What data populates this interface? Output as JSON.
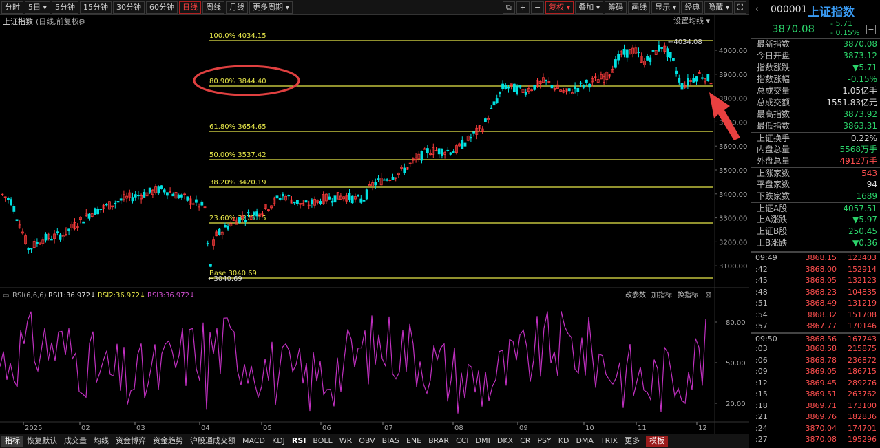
{
  "toolbar": {
    "items": [
      "分时",
      "5日 ▾",
      "5分钟",
      "15分钟",
      "30分钟",
      "60分钟",
      "日线",
      "周线",
      "月线",
      "更多周期 ▾"
    ],
    "right": [
      "复权 ▾",
      "叠加 ▾",
      "筹码",
      "画线",
      "显示 ▾",
      "经典",
      "隐藏 ▾"
    ]
  },
  "chart": {
    "title": "上证指数",
    "subtitle": "(日线,前复权)",
    "setting": "设置均线 ▾",
    "fib": [
      {
        "label": "100.0% 4034.15"
      },
      {
        "label": "80.90% 3844.40"
      },
      {
        "label": "61.80% 3654.65"
      },
      {
        "label": "50.00% 3537.42"
      },
      {
        "label": "38.20% 3420.19"
      },
      {
        "label": "23.60% 3275.15"
      },
      {
        "label": "Base   3040.69"
      }
    ],
    "high_label": "4034.08",
    "low_label": "3040.69",
    "yticks": [
      "4000.00",
      "3900.00",
      "3800.00",
      "3700.00",
      "3600.00",
      "3500.00",
      "3400.00",
      "3300.00",
      "3200.00",
      "3100.00"
    ]
  },
  "rsi": {
    "title": "RSI(6,6,6)",
    "rsi1": "RSI1:36.972",
    "rsi2": "RSI2:36.972",
    "rsi3": "RSI3:36.972",
    "actions": [
      "改参数",
      "加指标",
      "换指标"
    ],
    "yticks": [
      "80.00",
      "50.00",
      "20.00"
    ]
  },
  "xaxis": [
    "2025",
    "02",
    "03",
    "04",
    "05",
    "06",
    "07",
    "08",
    "09",
    "10",
    "11",
    "12"
  ],
  "bottom_tabs": [
    "指标",
    "恢复默认",
    "成交量",
    "均线",
    "资金博弈",
    "资金趋势",
    "沪股通成交额",
    "MACD",
    "KDJ",
    "RSI",
    "BOLL",
    "WR",
    "OBV",
    "BIAS",
    "ENE",
    "BRAR",
    "CCI",
    "DMI",
    "DKX",
    "CR",
    "PSY",
    "KD",
    "DMA",
    "TRIX",
    "更多",
    "模板"
  ],
  "panel": {
    "code": "000001",
    "name": "上证指数",
    "price": "3870.08",
    "change": "- 5.71",
    "change_pct": "- 0.15%",
    "quotes": [
      {
        "k": "最新指数",
        "v": "3870.08",
        "c": "g"
      },
      {
        "k": "今日开盘",
        "v": "3873.12",
        "c": "g"
      },
      {
        "k": "指数涨跌",
        "v": "▼5.71",
        "c": "g"
      },
      {
        "k": "指数涨幅",
        "v": "-0.15%",
        "c": "g"
      },
      {
        "k": "总成交量",
        "v": "1.05亿手",
        "c": "w"
      },
      {
        "k": "总成交额",
        "v": "1551.83亿元",
        "c": "w"
      },
      {
        "k": "最高指数",
        "v": "3873.92",
        "c": "g"
      },
      {
        "k": "最低指数",
        "v": "3863.31",
        "c": "g"
      },
      {
        "k": "上证换手",
        "v": "0.22%",
        "c": "w",
        "sep": true
      },
      {
        "k": "内盘总量",
        "v": "5568万手",
        "c": "g"
      },
      {
        "k": "外盘总量",
        "v": "4912万手",
        "c": "r"
      },
      {
        "k": "上涨家数",
        "v": "543",
        "c": "r",
        "sep": true
      },
      {
        "k": "平盘家数",
        "v": "94",
        "c": "w"
      },
      {
        "k": "下跌家数",
        "v": "1689",
        "c": "g"
      },
      {
        "k": "上证A股",
        "v": "4057.51",
        "c": "g",
        "sep": true
      },
      {
        "k": "上A涨跌",
        "v": "▼5.97",
        "c": "g"
      },
      {
        "k": "上证B股",
        "v": "250.45",
        "c": "g"
      },
      {
        "k": "上B涨跌",
        "v": "▼0.36",
        "c": "g"
      }
    ],
    "ticks": [
      {
        "t": "09:49",
        "p": "3868.15",
        "v": "123403",
        "vc": "g"
      },
      {
        "t": ":42",
        "p": "3868.00",
        "v": "152914",
        "vc": "g"
      },
      {
        "t": ":45",
        "p": "3868.05",
        "v": "132123",
        "vc": "r"
      },
      {
        "t": ":48",
        "p": "3868.23",
        "v": "104835",
        "vc": "r"
      },
      {
        "t": ":51",
        "p": "3868.49",
        "v": "131219",
        "vc": "r"
      },
      {
        "t": ":54",
        "p": "3868.32",
        "v": "151708",
        "vc": "g"
      },
      {
        "t": ":57",
        "p": "3867.77",
        "v": "170146",
        "vc": "g"
      },
      {
        "t": "09:50",
        "p": "3868.56",
        "v": "167743",
        "vc": "r",
        "sep": true
      },
      {
        "t": ":03",
        "p": "3868.58",
        "v": "215875",
        "vc": "r"
      },
      {
        "t": ":06",
        "p": "3868.78",
        "v": "236872",
        "vc": "r"
      },
      {
        "t": ":09",
        "p": "3869.05",
        "v": "186715",
        "vc": "r"
      },
      {
        "t": ":12",
        "p": "3869.45",
        "v": "289276",
        "vc": "r"
      },
      {
        "t": ":15",
        "p": "3869.51",
        "v": "263762",
        "vc": "r"
      },
      {
        "t": ":18",
        "p": "3869.71",
        "v": "173100",
        "vc": "r"
      },
      {
        "t": ":21",
        "p": "3869.76",
        "v": "182836",
        "vc": "r"
      },
      {
        "t": ":24",
        "p": "3870.04",
        "v": "174701",
        "vc": "r"
      },
      {
        "t": ":27",
        "p": "3870.08",
        "v": "195296",
        "vc": "r"
      }
    ]
  },
  "colors": {
    "up": "#ff3c3c",
    "down": "#00e0e0",
    "fib": "#e8e84a",
    "rsi": "#c030c0",
    "highlight": "#e04040"
  }
}
